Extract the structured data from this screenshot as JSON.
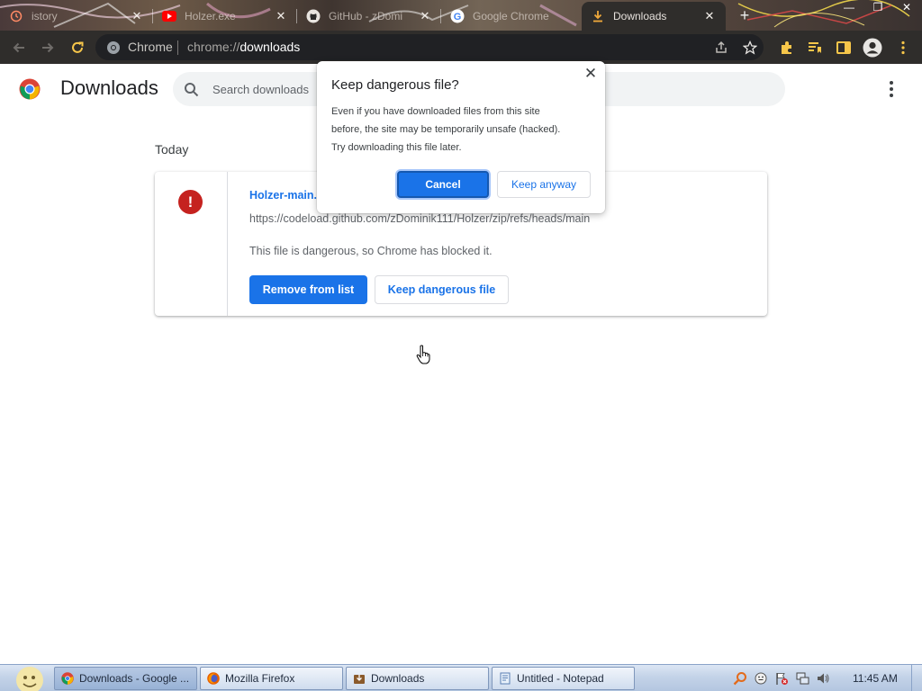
{
  "browser": {
    "tabs": [
      {
        "title": "istory",
        "icon": "history-icon",
        "active": false
      },
      {
        "title": "Holzer.exe",
        "icon": "youtube-icon",
        "active": false
      },
      {
        "title": "GitHub - zDomi",
        "icon": "github-icon",
        "active": false
      },
      {
        "title": "Google Chrome",
        "icon": "google-icon",
        "active": false
      },
      {
        "title": "Downloads",
        "icon": "download-icon",
        "active": true
      }
    ],
    "new_tab_label": "+",
    "window_controls": [
      "minimize",
      "maximize",
      "close"
    ],
    "omnibox": {
      "site_chip": "Chrome",
      "url_scheme": "chrome://",
      "url_path": "downloads"
    },
    "toolbar_icons": [
      "back-icon",
      "forward-icon",
      "reload-icon",
      "share-icon",
      "bookmark-star-icon",
      "extensions-icon",
      "reading-list-icon",
      "side-panel-icon",
      "profile-icon",
      "menu-icon"
    ]
  },
  "page": {
    "title": "Downloads",
    "search_placeholder": "Search downloads",
    "section_date": "Today",
    "download": {
      "file_name": "Holzer-main.",
      "url": "https://codeload.github.com/zDominik111/Holzer/zip/refs/heads/main",
      "description": "This file is dangerous, so Chrome has blocked it.",
      "remove_label": "Remove from list",
      "keep_label": "Keep dangerous file",
      "danger_symbol": "!"
    }
  },
  "dialog": {
    "title": "Keep dangerous file?",
    "body_lines": [
      "Even if you have downloaded files from this site",
      "before, the site may be temporarily unsafe (hacked).",
      "Try downloading this file later."
    ],
    "cancel_label": "Cancel",
    "keep_label": "Keep anyway",
    "close_symbol": "✕"
  },
  "taskbar": {
    "tasks": [
      {
        "label": "Downloads - Google ...",
        "icon": "chrome-icon",
        "active": true
      },
      {
        "label": "Mozilla Firefox",
        "icon": "firefox-icon",
        "active": false
      },
      {
        "label": "Downloads",
        "icon": "folder-downloads-icon",
        "active": false
      },
      {
        "label": "Untitled - Notepad",
        "icon": "notepad-icon",
        "active": false
      }
    ],
    "clock": "11:45 AM",
    "tray_icons": [
      "search-tray-icon",
      "emoji-tray-icon",
      "flag-warning-icon",
      "network-icon",
      "volume-icon"
    ]
  },
  "colors": {
    "accent": "#1a73e8",
    "danger": "#c5221f",
    "toolbar_bg": "#2f2d2b",
    "page_bg": "#ffffff"
  }
}
